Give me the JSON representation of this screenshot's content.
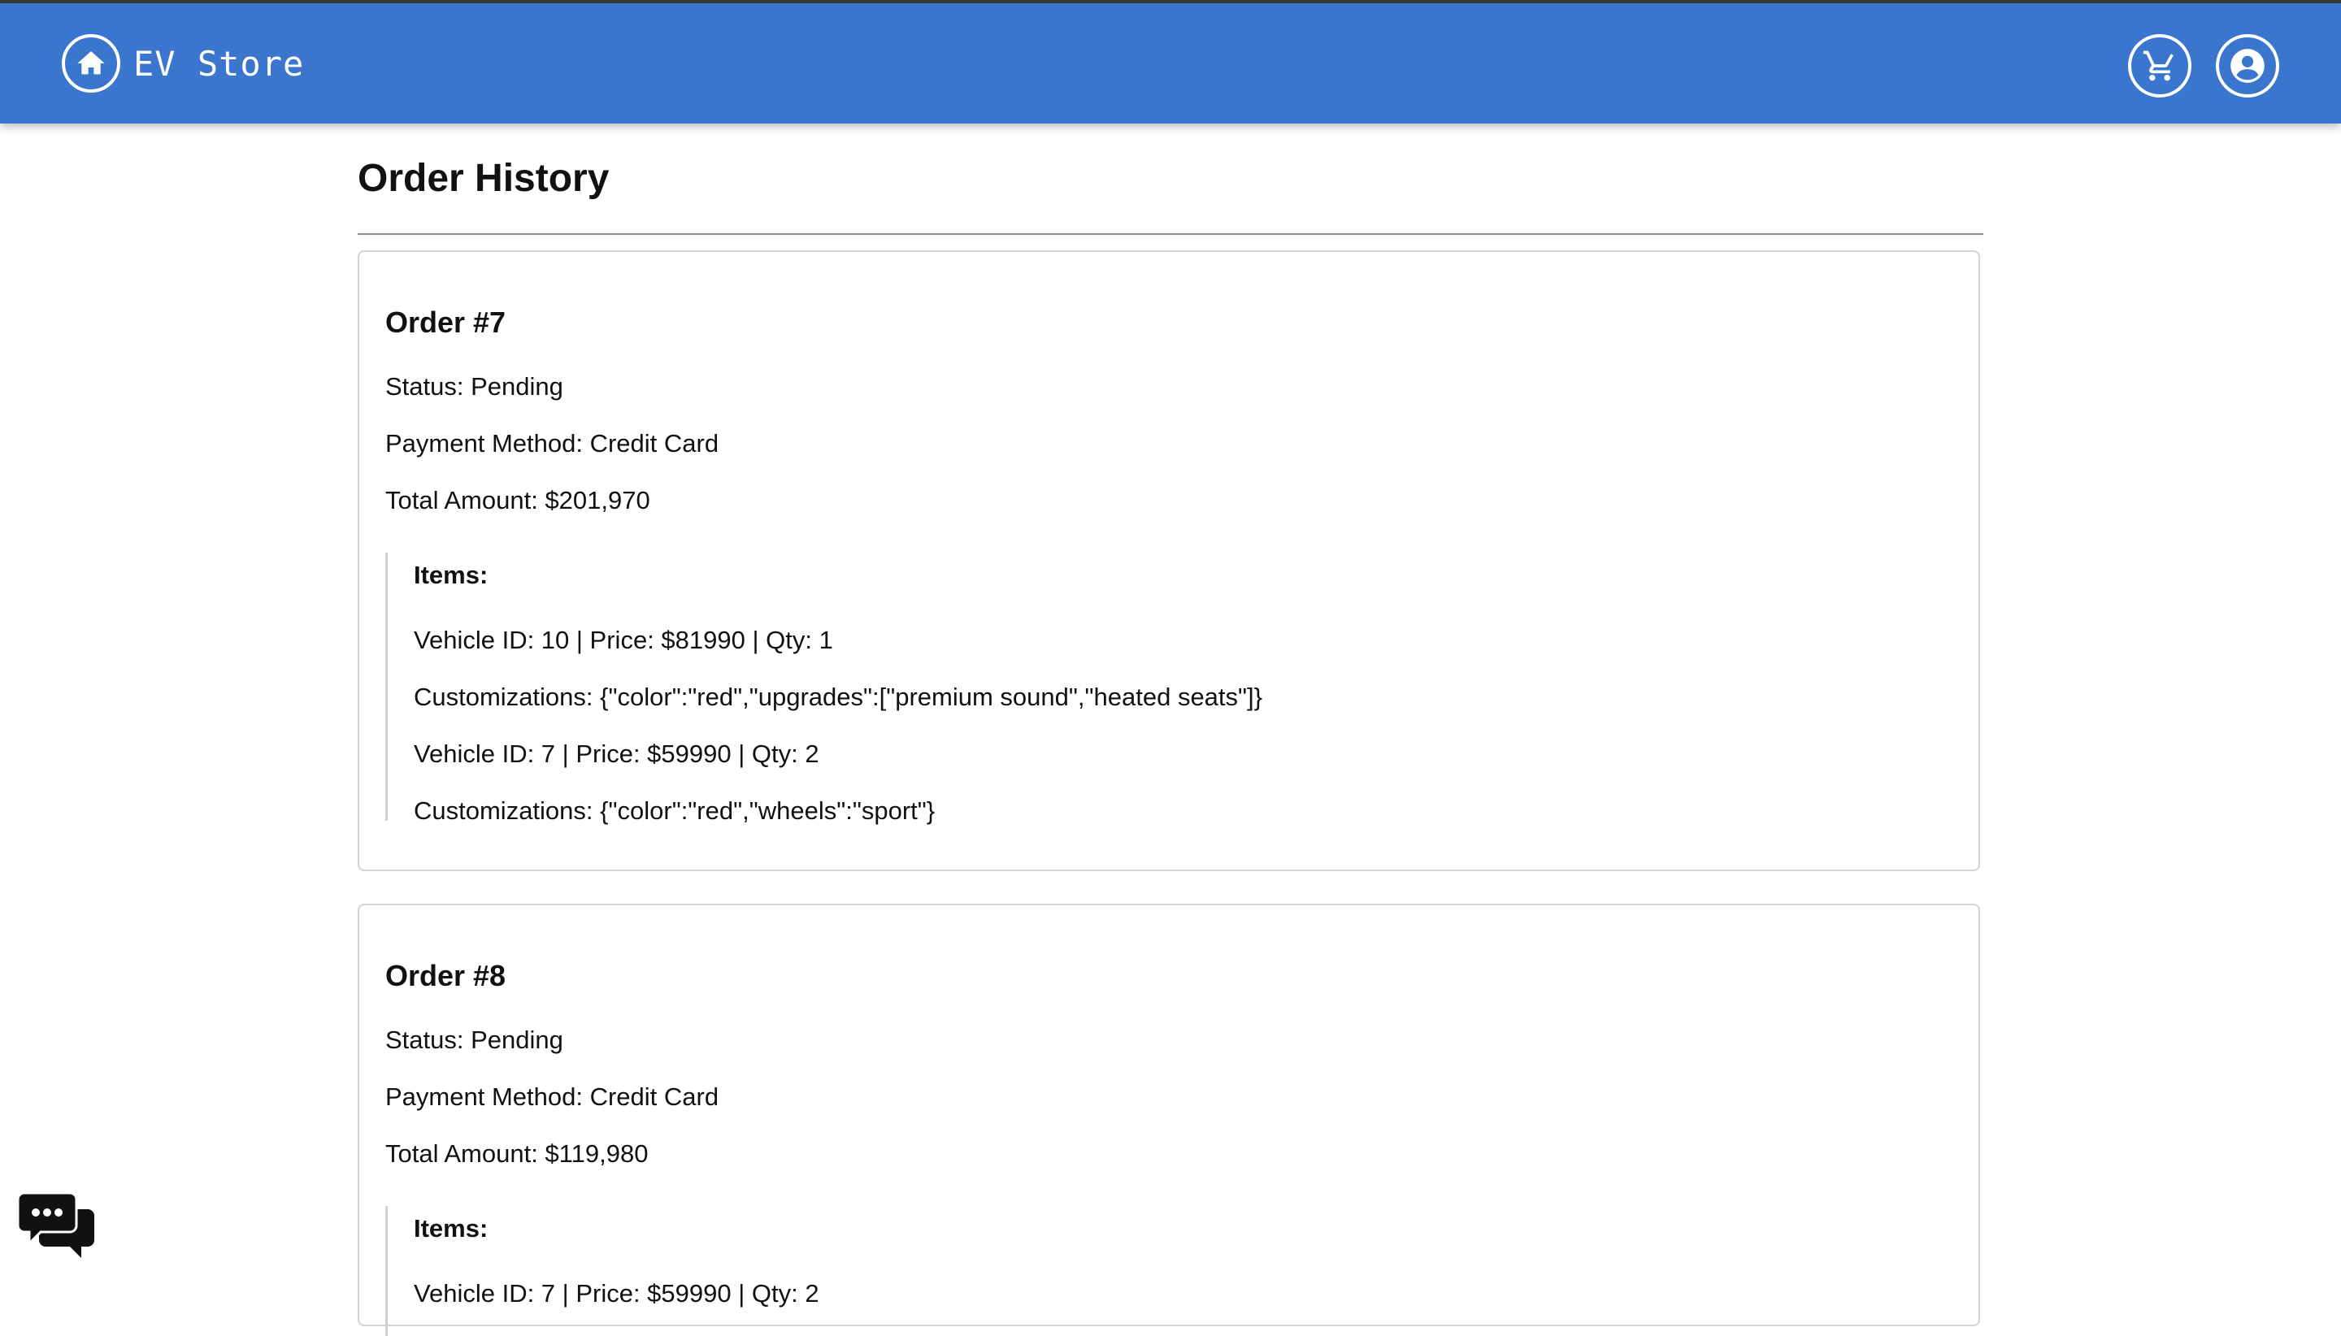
{
  "app": {
    "brand": "EV Store",
    "accent_color": "#3a75ce"
  },
  "nav": {
    "icons": [
      "home-icon",
      "cart-icon",
      "account-icon"
    ]
  },
  "page": {
    "title": "Order History"
  },
  "orders": [
    {
      "title": "Order #7",
      "status": "Status: Pending",
      "payment": "Payment Method: Credit Card",
      "total": "Total Amount: $201,970",
      "items_label": "Items:",
      "lines": [
        "Vehicle ID: 10  |  Price: $81990  |  Qty: 1",
        "Customizations: {\"color\":\"red\",\"upgrades\":[\"premium sound\",\"heated seats\"]}",
        "Vehicle ID: 7  |  Price: $59990  |  Qty: 2",
        "Customizations: {\"color\":\"red\",\"wheels\":\"sport\"}"
      ]
    },
    {
      "title": "Order #8",
      "status": "Status: Pending",
      "payment": "Payment Method: Credit Card",
      "total": "Total Amount: $119,980",
      "items_label": "Items:",
      "lines": [
        "Vehicle ID: 7  |  Price: $59990  |  Qty: 2"
      ]
    }
  ],
  "chat": {
    "icon": "chat-bubbles-icon"
  }
}
